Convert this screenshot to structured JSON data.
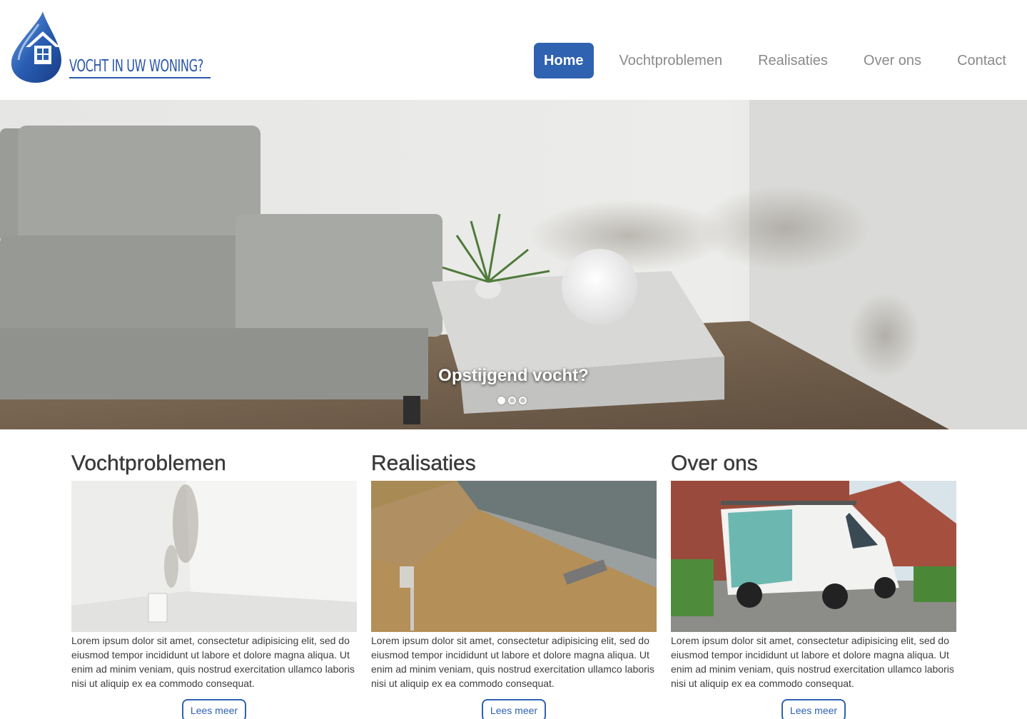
{
  "brand": {
    "logo_text": "VOCHT IN UW WONING?",
    "primary_color": "#2f62b0",
    "logo_color": "#2b57a8"
  },
  "nav": {
    "items": [
      {
        "label": "Home",
        "active": true
      },
      {
        "label": "Vochtproblemen",
        "active": false
      },
      {
        "label": "Realisaties",
        "active": false
      },
      {
        "label": "Over ons",
        "active": false
      },
      {
        "label": "Contact",
        "active": false
      }
    ]
  },
  "hero": {
    "caption": "Opstijgend vocht?",
    "slide_count": 3,
    "active_slide": 1
  },
  "sections": [
    {
      "title": "Vochtproblemen",
      "text": "Lorem ipsum dolor sit amet, consectetur adipisicing elit, sed do eiusmod tempor incididunt ut labore et dolore magna aliqua. Ut enim ad minim veniam, quis nostrud exercitation ullamco laboris nisi ut aliquip ex ea commodo consequat.",
      "button": "Lees meer"
    },
    {
      "title": "Realisaties",
      "text": "Lorem ipsum dolor sit amet, consectetur adipisicing elit, sed do eiusmod tempor incididunt ut labore et dolore magna aliqua. Ut enim ad minim veniam, quis nostrud exercitation ullamco laboris nisi ut aliquip ex ea commodo consequat.",
      "button": "Lees meer"
    },
    {
      "title": "Over ons",
      "text": "Lorem ipsum dolor sit amet, consectetur adipisicing elit, sed do eiusmod tempor incididunt ut labore et dolore magna aliqua. Ut enim ad minim veniam, quis nostrud exercitation ullamco laboris nisi ut aliquip ex ea commodo consequat.",
      "button": "Lees meer"
    }
  ]
}
